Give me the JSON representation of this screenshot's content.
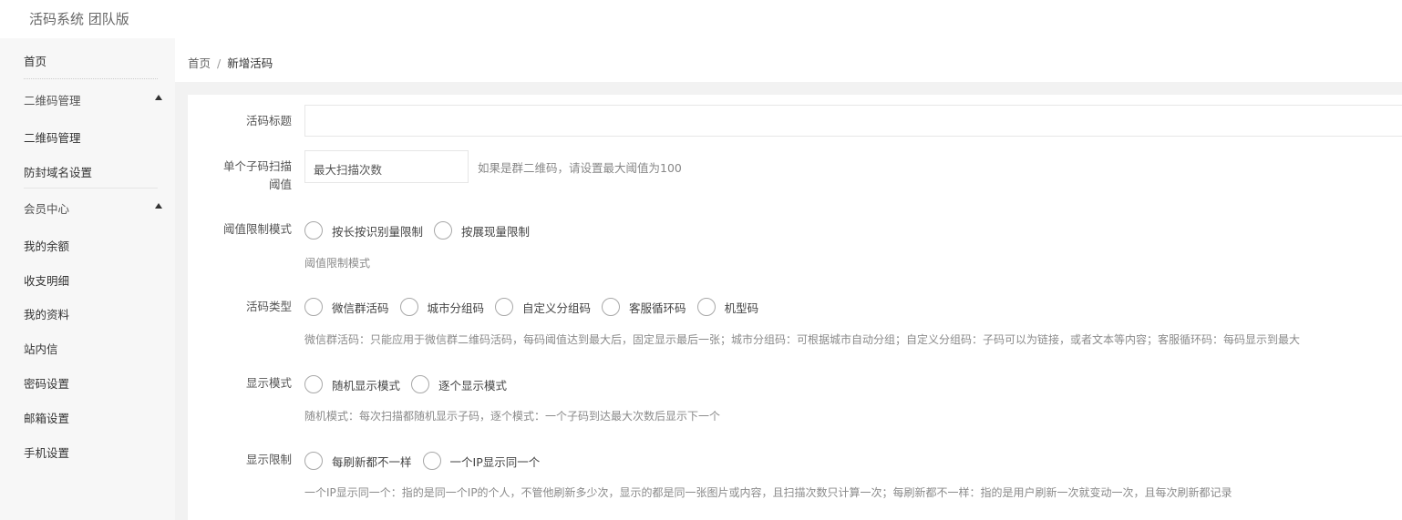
{
  "app": {
    "title": "活码系统 团队版"
  },
  "sidebar": {
    "home": "首页",
    "group_qr": "二维码管理",
    "qr_manage": "二维码管理",
    "anti_block": "防封域名设置",
    "group_member": "会员中心",
    "balance": "我的余额",
    "transactions": "收支明细",
    "profile": "我的资料",
    "messages": "站内信",
    "password": "密码设置",
    "email": "邮箱设置",
    "phone": "手机设置"
  },
  "breadcrumb": {
    "home": "首页",
    "sep": "/",
    "current": "新增活码"
  },
  "form": {
    "title_label": "活码标题",
    "title_value": "",
    "scan_label_line1": "单个子码扫描",
    "scan_label_line2": "阈值",
    "scan_placeholder": "最大扫描次数",
    "scan_hint": "如果是群二维码，请设置最大阈值为100",
    "threshold_label": "阈值限制模式",
    "threshold_options": [
      "按长按识别量限制",
      "按展现量限制"
    ],
    "threshold_hint": "阈值限制模式",
    "type_label": "活码类型",
    "type_options": [
      "微信群活码",
      "城市分组码",
      "自定义分组码",
      "客服循环码",
      "机型码"
    ],
    "type_hint": "微信群活码：只能应用于微信群二维码活码，每码阈值达到最大后，固定显示最后一张；城市分组码：可根据城市自动分组；自定义分组码：子码可以为链接，或者文本等内容；客服循环码：每码显示到最大",
    "display_label": "显示模式",
    "display_options": [
      "随机显示模式",
      "逐个显示模式"
    ],
    "display_hint": "随机模式：每次扫描都随机显示子码，逐个模式：一个子码到达最大次数后显示下一个",
    "limit_label": "显示限制",
    "limit_options": [
      "每刷新都不一样",
      "一个IP显示同一个"
    ],
    "limit_hint": "一个IP显示同一个：指的是同一个IP的个人，不管他刷新多少次，显示的都是同一张图片或内容，且扫描次数只计算一次；每刷新都不一样：指的是用户刷新一次就变动一次，且每次刷新都记录"
  }
}
